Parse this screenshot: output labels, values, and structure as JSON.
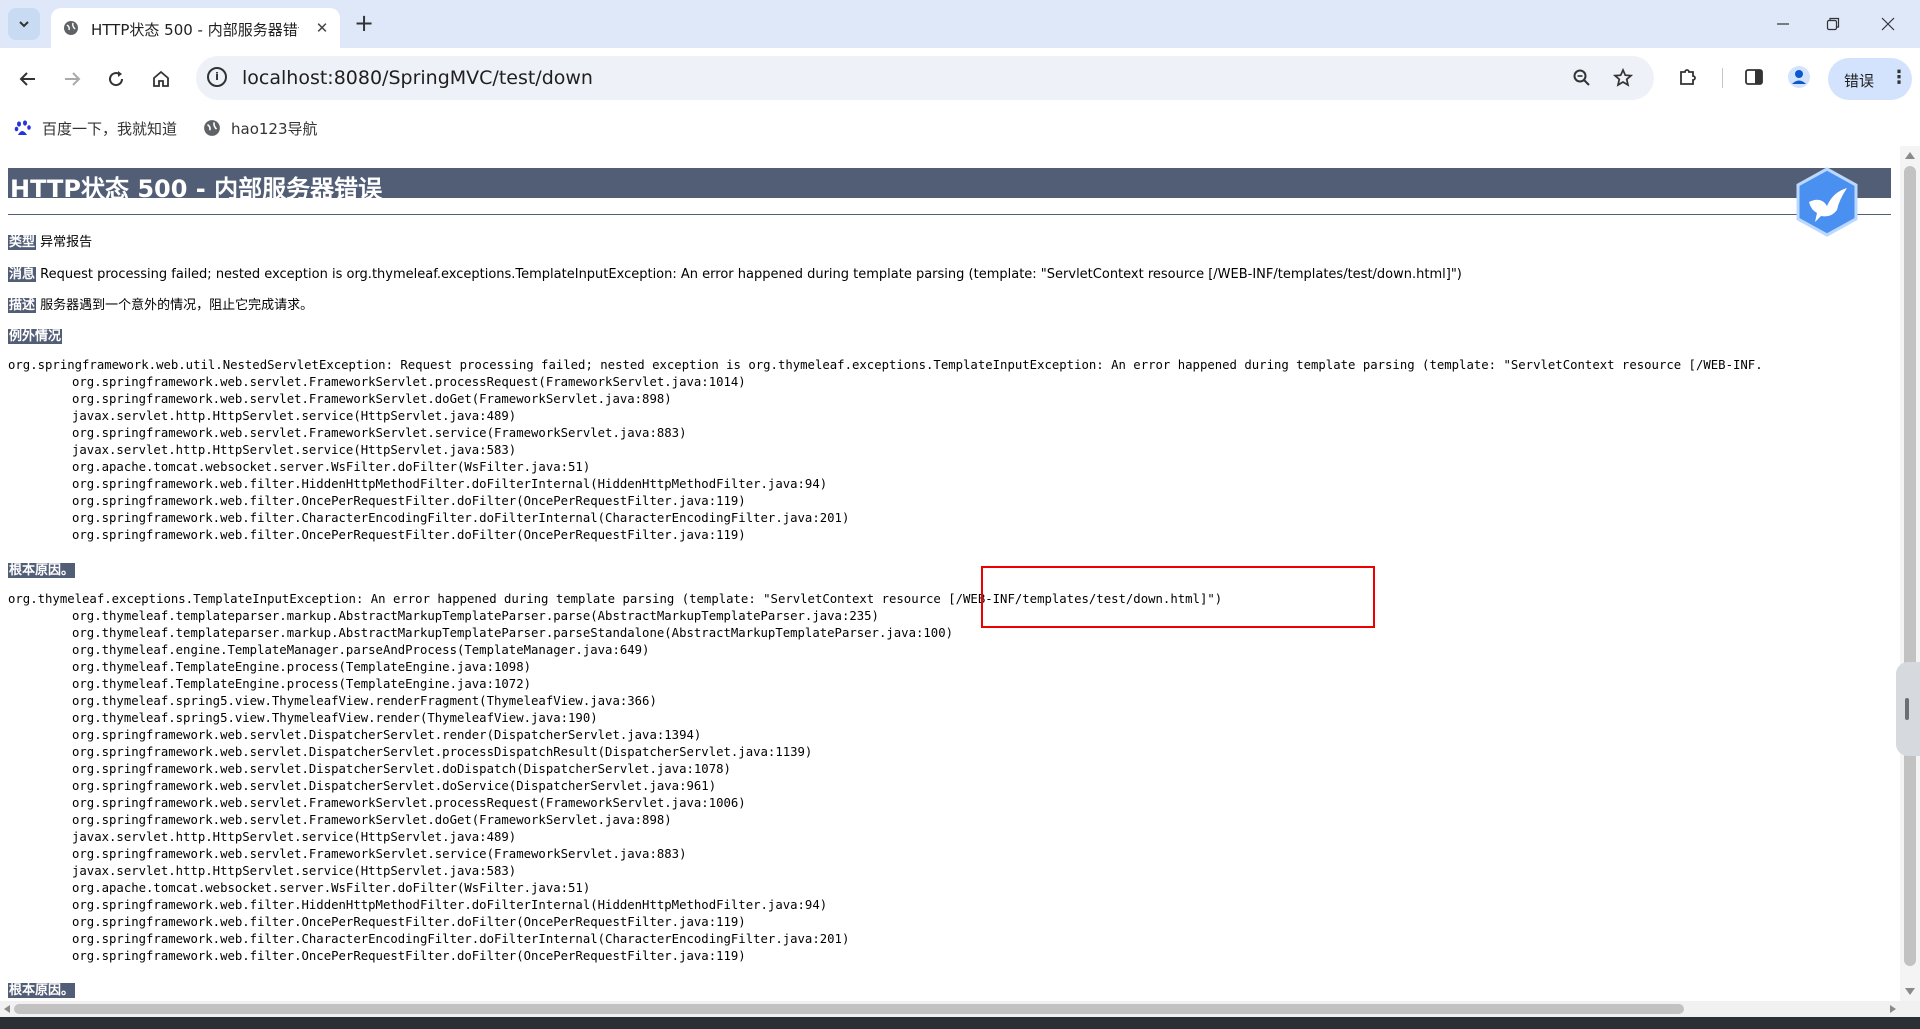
{
  "browser": {
    "tab_title": "HTTP状态 500 - 内部服务器错误",
    "url": "localhost:8080/SpringMVC/test/down",
    "profile_label": "错误",
    "bookmarks": [
      {
        "label": "百度一下，我就知道",
        "icon": "baidu-paw-icon"
      },
      {
        "label": "hao123导航",
        "icon": "globe-icon"
      }
    ]
  },
  "page": {
    "heading": "HTTP状态 500 - 内部服务器错误",
    "type_label": "类型",
    "type_value": "异常报告",
    "message_label": "消息",
    "message_value": "Request processing failed; nested exception is org.thymeleaf.exceptions.TemplateInputException: An error happened during template parsing (template: \"ServletContext resource [/WEB-INF/templates/test/down.html]\")",
    "description_label": "描述",
    "description_value": "服务器遇到一个意外的情况，阻止它完成请求。",
    "exception_label": "例外情况",
    "exception_trace": [
      "org.springframework.web.util.NestedServletException: Request processing failed; nested exception is org.thymeleaf.exceptions.TemplateInputException: An error happened during template parsing (template: \"ServletContext resource [/WEB-INF.",
      "org.springframework.web.servlet.FrameworkServlet.processRequest(FrameworkServlet.java:1014)",
      "org.springframework.web.servlet.FrameworkServlet.doGet(FrameworkServlet.java:898)",
      "javax.servlet.http.HttpServlet.service(HttpServlet.java:489)",
      "org.springframework.web.servlet.FrameworkServlet.service(FrameworkServlet.java:883)",
      "javax.servlet.http.HttpServlet.service(HttpServlet.java:583)",
      "org.apache.tomcat.websocket.server.WsFilter.doFilter(WsFilter.java:51)",
      "org.springframework.web.filter.HiddenHttpMethodFilter.doFilterInternal(HiddenHttpMethodFilter.java:94)",
      "org.springframework.web.filter.OncePerRequestFilter.doFilter(OncePerRequestFilter.java:119)",
      "org.springframework.web.filter.CharacterEncodingFilter.doFilterInternal(CharacterEncodingFilter.java:201)",
      "org.springframework.web.filter.OncePerRequestFilter.doFilter(OncePerRequestFilter.java:119)"
    ],
    "root_cause_label": "根本原因。",
    "root_cause_trace": [
      "org.thymeleaf.exceptions.TemplateInputException: An error happened during template parsing (template: \"ServletContext resource [/WEB-INF/templates/test/down.html]\")",
      "org.thymeleaf.templateparser.markup.AbstractMarkupTemplateParser.parse(AbstractMarkupTemplateParser.java:235)",
      "org.thymeleaf.templateparser.markup.AbstractMarkupTemplateParser.parseStandalone(AbstractMarkupTemplateParser.java:100)",
      "org.thymeleaf.engine.TemplateManager.parseAndProcess(TemplateManager.java:649)",
      "org.thymeleaf.TemplateEngine.process(TemplateEngine.java:1098)",
      "org.thymeleaf.TemplateEngine.process(TemplateEngine.java:1072)",
      "org.thymeleaf.spring5.view.ThymeleafView.renderFragment(ThymeleafView.java:366)",
      "org.thymeleaf.spring5.view.ThymeleafView.render(ThymeleafView.java:190)",
      "org.springframework.web.servlet.DispatcherServlet.render(DispatcherServlet.java:1394)",
      "org.springframework.web.servlet.DispatcherServlet.processDispatchResult(DispatcherServlet.java:1139)",
      "org.springframework.web.servlet.DispatcherServlet.doDispatch(DispatcherServlet.java:1078)",
      "org.springframework.web.servlet.DispatcherServlet.doService(DispatcherServlet.java:961)",
      "org.springframework.web.servlet.FrameworkServlet.processRequest(FrameworkServlet.java:1006)",
      "org.springframework.web.servlet.FrameworkServlet.doGet(FrameworkServlet.java:898)",
      "javax.servlet.http.HttpServlet.service(HttpServlet.java:489)",
      "org.springframework.web.servlet.FrameworkServlet.service(FrameworkServlet.java:883)",
      "javax.servlet.http.HttpServlet.service(HttpServlet.java:583)",
      "org.apache.tomcat.websocket.server.WsFilter.doFilter(WsFilter.java:51)",
      "org.springframework.web.filter.HiddenHttpMethodFilter.doFilterInternal(HiddenHttpMethodFilter.java:94)",
      "org.springframework.web.filter.OncePerRequestFilter.doFilter(OncePerRequestFilter.java:119)",
      "org.springframework.web.filter.CharacterEncodingFilter.doFilterInternal(CharacterEncodingFilter.java:201)",
      "org.springframework.web.filter.OncePerRequestFilter.doFilter(OncePerRequestFilter.java:119)"
    ],
    "root_cause_label_2": "根本原因。"
  },
  "colors": {
    "tomcat_header": "#525d76",
    "annotation_box": "#e00000",
    "tab_strip": "#dee8f8"
  }
}
